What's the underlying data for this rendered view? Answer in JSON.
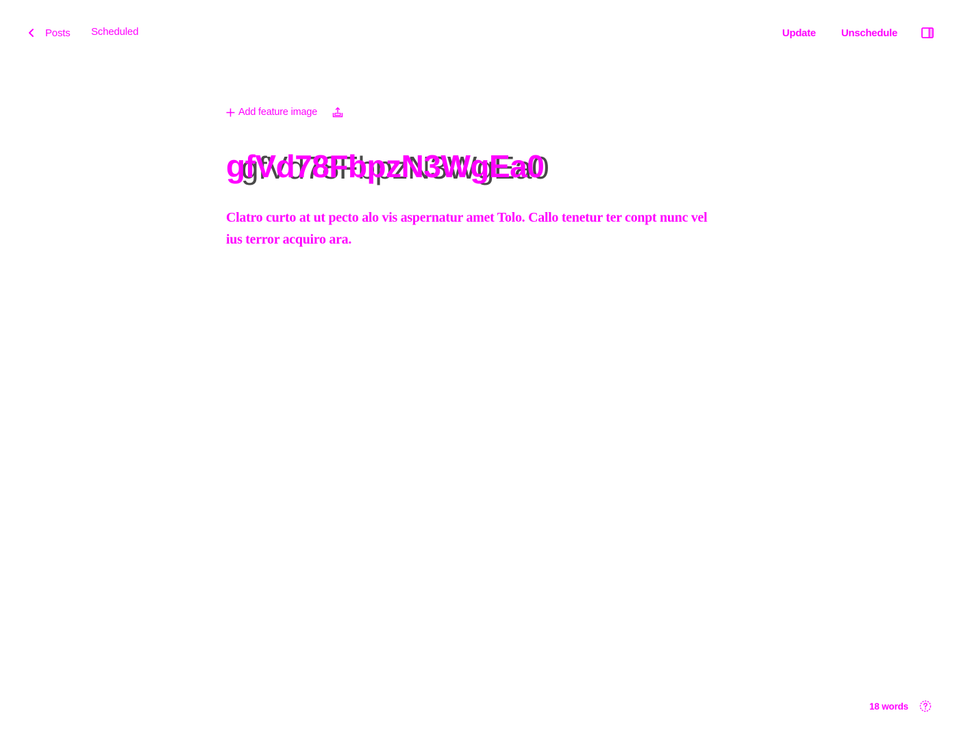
{
  "header": {
    "back_label": "Posts",
    "status": "Scheduled",
    "update_label": "Update",
    "unschedule_label": "Unschedule",
    "settings_toggle_icon": "sidebar-panel-icon"
  },
  "editor": {
    "feature_image_label": "Add feature image",
    "feature_image_icon": "plus-icon",
    "upload_icon": "upload-icon",
    "title": "gfVd78FbpzN3WgEa0",
    "excerpt": "Clatro curto at ut pecto alo vis aspernatur amet Tolo. Callo tenetur ter conpt nunc vel ius terror acquiro ara."
  },
  "footer": {
    "word_count": "18 words",
    "help_icon": "question-circle-icon"
  },
  "colors": {
    "accent": "#ff00ff",
    "background": "#ffffff",
    "ghost_text": "#2a2a2a"
  }
}
